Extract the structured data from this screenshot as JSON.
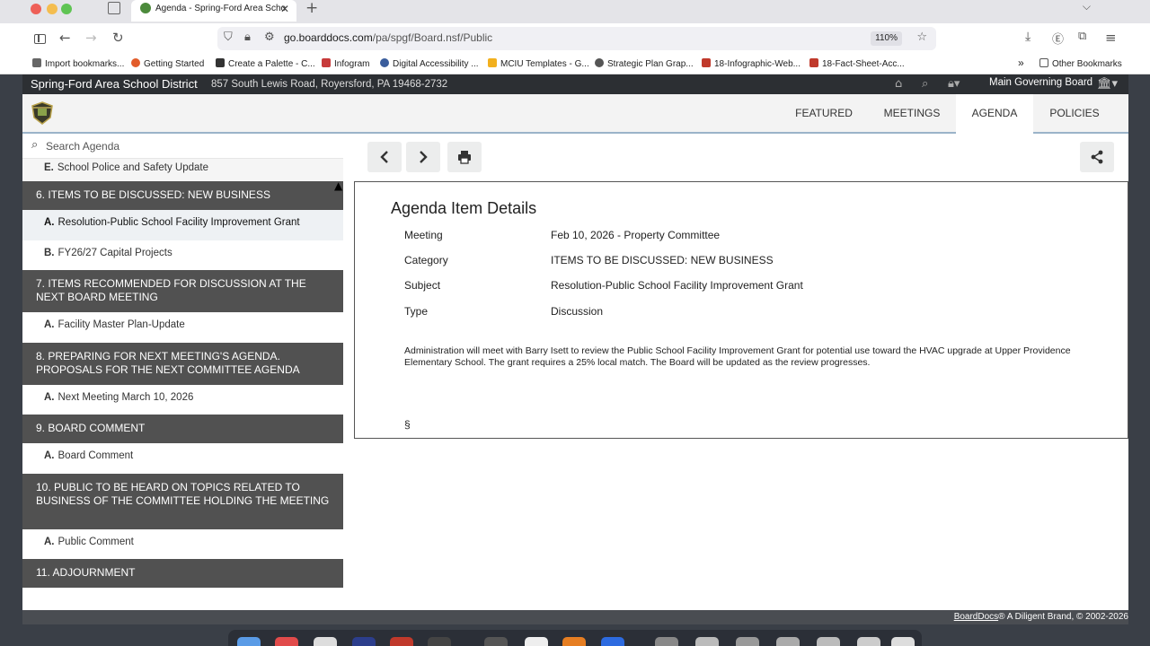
{
  "browser": {
    "tab_title": "Agenda - Spring-Ford Area Scho",
    "tab_close": "✕",
    "new_tab": "+",
    "url_domain": "go.boarddocs.com",
    "url_path": "/pa/spgf/Board.nsf/Public",
    "zoom": "110%",
    "bookmarks": [
      {
        "label": "Import bookmarks...",
        "icon_color": "#666666"
      },
      {
        "label": "Getting Started",
        "icon_color": "#e25c2a"
      },
      {
        "label": "Create a Palette - C...",
        "icon_color": "#333333"
      },
      {
        "label": "Infogram",
        "icon_color": "#c73a3a"
      },
      {
        "label": "Digital Accessibility ...",
        "icon_color": "#3a5d9c"
      },
      {
        "label": "MCIU Templates - G...",
        "icon_color": "#f2b01e"
      },
      {
        "label": "Strategic Plan Grap...",
        "icon_color": "#555555"
      },
      {
        "label": "18-Infographic-Web...",
        "icon_color": "#c0392b"
      },
      {
        "label": "18-Fact-Sheet-Acc...",
        "icon_color": "#c0392b"
      }
    ],
    "other_bookmarks": "Other Bookmarks",
    "more_bookmarks": "»"
  },
  "site": {
    "district_name": "Spring-Ford Area School District",
    "address": "857 South Lewis Road, Royersford, PA 19468-2732",
    "board_select": "Main Governing Board",
    "nav": [
      {
        "label": "FEATURED",
        "active": false
      },
      {
        "label": "MEETINGS",
        "active": false
      },
      {
        "label": "AGENDA",
        "active": true
      },
      {
        "label": "POLICIES",
        "active": false
      }
    ],
    "accent_color": "#2c2f33",
    "section_color": "#515151"
  },
  "agenda": {
    "search_placeholder": "Search Agenda",
    "entries": [
      {
        "kind": "item",
        "letter": "E.",
        "text": "School Police and Safety Update",
        "first": true
      },
      {
        "kind": "section",
        "text": "6. ITEMS TO BE DISCUSSED: NEW BUSINESS",
        "lines": 1
      },
      {
        "kind": "item",
        "letter": "A.",
        "text": "Resolution-Public School Facility Improvement Grant",
        "selected": true
      },
      {
        "kind": "item",
        "letter": "B.",
        "text": "FY26/27 Capital Projects"
      },
      {
        "kind": "section",
        "text": "7. ITEMS RECOMMENDED FOR DISCUSSION AT THE NEXT BOARD MEETING",
        "lines": 2
      },
      {
        "kind": "item",
        "letter": "A.",
        "text": "Facility Master Plan-Update"
      },
      {
        "kind": "section",
        "text": "8. PREPARING FOR NEXT MEETING'S AGENDA. PROPOSALS FOR THE NEXT COMMITTEE AGENDA",
        "lines": 2
      },
      {
        "kind": "item",
        "letter": "A.",
        "text": "Next Meeting March 10, 2026"
      },
      {
        "kind": "section",
        "text": "9. BOARD COMMENT",
        "lines": 1
      },
      {
        "kind": "item",
        "letter": "A.",
        "text": "Board Comment"
      },
      {
        "kind": "section",
        "text": "10. PUBLIC TO BE HEARD ON TOPICS RELATED TO BUSINESS OF THE COMMITTEE HOLDING THE MEETING",
        "lines": 3
      },
      {
        "kind": "item",
        "letter": "A.",
        "text": "Public Comment"
      },
      {
        "kind": "section",
        "text": "11. ADJOURNMENT",
        "lines": 1
      }
    ]
  },
  "details": {
    "title": "Agenda Item Details",
    "rows": [
      {
        "label": "Meeting",
        "value": "Feb 10, 2026 - Property Committee"
      },
      {
        "label": "Category",
        "value": "ITEMS TO BE DISCUSSED: NEW BUSINESS"
      },
      {
        "label": "Subject",
        "value": "Resolution-Public School Facility Improvement Grant"
      },
      {
        "label": "Type",
        "value": "Discussion"
      }
    ],
    "description": "Administration will meet with Barry Isett to review the Public School Facility Improvement Grant for potential use toward the HVAC upgrade at Upper Providence Elementary School. The grant requires a 25% local match. The Board will be updated as the review progresses.",
    "section_mark": "§"
  },
  "footer": {
    "brand": "BoardDocs",
    "text": "® A Diligent Brand, © 2002-2026"
  }
}
